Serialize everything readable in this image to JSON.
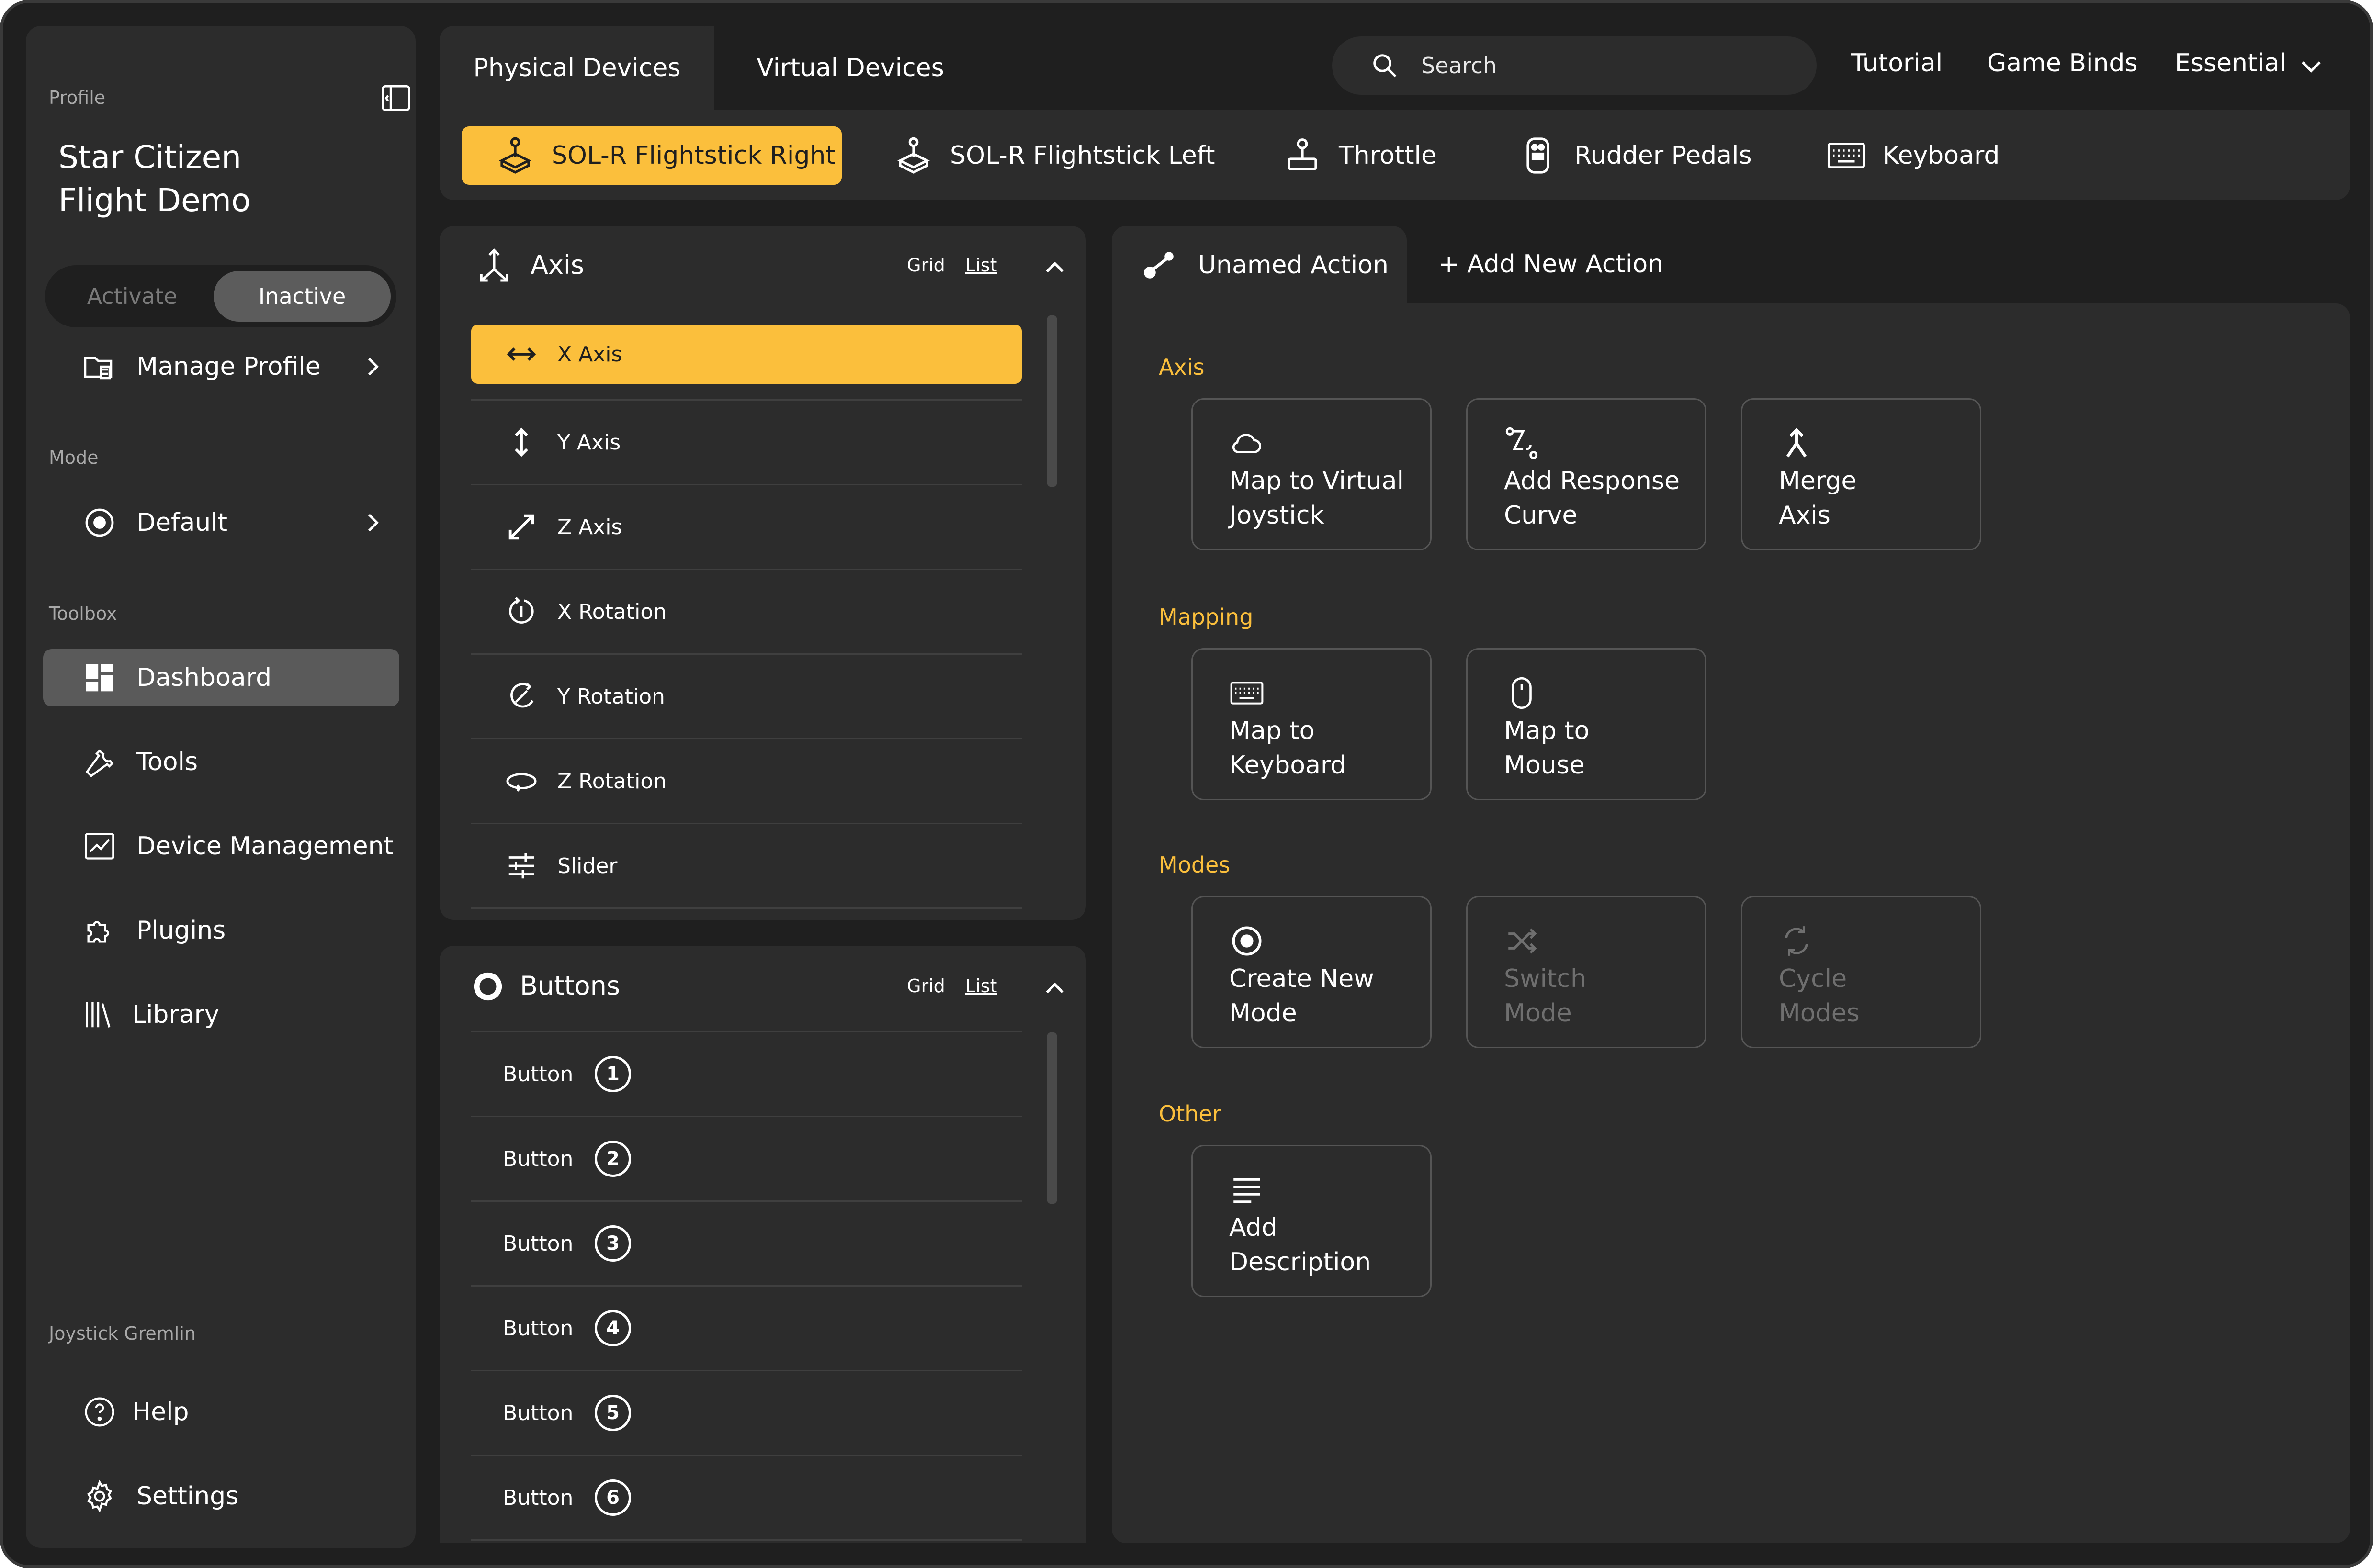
{
  "sidebar": {
    "profile_label": "Profile",
    "profile_name_line1": "Star Citizen",
    "profile_name_line2": "Flight Demo",
    "activate_label": "Activate",
    "inactive_label": "Inactive",
    "manage_profile": "Manage Profile",
    "mode_label": "Mode",
    "mode_value": "Default",
    "toolbox_label": "Toolbox",
    "toolbox_items": [
      "Dashboard",
      "Tools",
      "Device Management",
      "Plugins",
      "Library"
    ],
    "footer_label": "Joystick Gremlin",
    "help": "Help",
    "settings": "Settings"
  },
  "header": {
    "tabs": [
      "Physical Devices",
      "Virtual Devices"
    ],
    "search_placeholder": "Search",
    "links": [
      "Tutorial",
      "Game Binds",
      "Essential"
    ],
    "devices": [
      "SOL-R Flightstick Right",
      "SOL-R Flightstick Left",
      "Throttle",
      "Rudder Pedals",
      "Keyboard"
    ]
  },
  "axis_panel": {
    "title": "Axis",
    "grid_label": "Grid",
    "list_label": "List",
    "items": [
      "X Axis",
      "Y Axis",
      "Z Axis",
      "X Rotation",
      "Y Rotation",
      "Z Rotation",
      "Slider"
    ]
  },
  "buttons_panel": {
    "title": "Buttons",
    "grid_label": "Grid",
    "list_label": "List",
    "button_label": "Button",
    "numbers": [
      "1",
      "2",
      "3",
      "4",
      "5",
      "6"
    ]
  },
  "action_panel": {
    "tab_label": "Unamed Action",
    "add_label": "+ Add New Action",
    "sections": {
      "axis": "Axis",
      "mapping": "Mapping",
      "modes": "Modes",
      "other": "Other"
    },
    "cards": {
      "map_virtual_1": "Map to Virtual",
      "map_virtual_2": "Joystick",
      "response_1": "Add Response",
      "response_2": "Curve",
      "merge_1": "Merge",
      "merge_2": "Axis",
      "keyboard_1": "Map to",
      "keyboard_2": "Keyboard",
      "mouse_1": "Map to",
      "mouse_2": "Mouse",
      "create_mode_1": "Create New",
      "create_mode_2": "Mode",
      "switch_1": "Switch",
      "switch_2": "Mode",
      "cycle_1": "Cycle",
      "cycle_2": "Modes",
      "desc_1": "Add",
      "desc_2": "Description"
    }
  },
  "colors": {
    "accent": "#fbbf3c",
    "background": "#1f1f1f",
    "panel": "#2c2c2c",
    "selected_nav": "#5a5a5a"
  }
}
